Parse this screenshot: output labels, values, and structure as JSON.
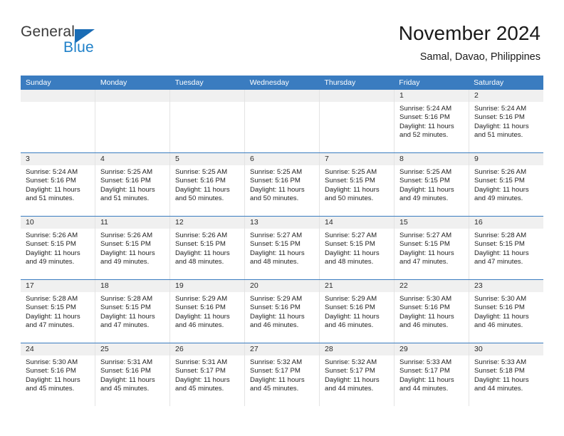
{
  "brand": {
    "name_part1": "General",
    "name_part2": "Blue"
  },
  "header": {
    "title": "November 2024",
    "subtitle": "Samal, Davao, Philippines"
  },
  "weekdays": [
    "Sunday",
    "Monday",
    "Tuesday",
    "Wednesday",
    "Thursday",
    "Friday",
    "Saturday"
  ],
  "colors": {
    "header_blue": "#3a7cc0",
    "logo_blue": "#2081c9",
    "day_bar_gray": "#f0f0f0"
  },
  "weeks": [
    [
      {
        "day": "",
        "empty": true
      },
      {
        "day": "",
        "empty": true
      },
      {
        "day": "",
        "empty": true
      },
      {
        "day": "",
        "empty": true
      },
      {
        "day": "",
        "empty": true
      },
      {
        "day": "1",
        "sunrise": "Sunrise: 5:24 AM",
        "sunset": "Sunset: 5:16 PM",
        "daylight1": "Daylight: 11 hours",
        "daylight2": "and 52 minutes."
      },
      {
        "day": "2",
        "sunrise": "Sunrise: 5:24 AM",
        "sunset": "Sunset: 5:16 PM",
        "daylight1": "Daylight: 11 hours",
        "daylight2": "and 51 minutes."
      }
    ],
    [
      {
        "day": "3",
        "sunrise": "Sunrise: 5:24 AM",
        "sunset": "Sunset: 5:16 PM",
        "daylight1": "Daylight: 11 hours",
        "daylight2": "and 51 minutes."
      },
      {
        "day": "4",
        "sunrise": "Sunrise: 5:25 AM",
        "sunset": "Sunset: 5:16 PM",
        "daylight1": "Daylight: 11 hours",
        "daylight2": "and 51 minutes."
      },
      {
        "day": "5",
        "sunrise": "Sunrise: 5:25 AM",
        "sunset": "Sunset: 5:16 PM",
        "daylight1": "Daylight: 11 hours",
        "daylight2": "and 50 minutes."
      },
      {
        "day": "6",
        "sunrise": "Sunrise: 5:25 AM",
        "sunset": "Sunset: 5:16 PM",
        "daylight1": "Daylight: 11 hours",
        "daylight2": "and 50 minutes."
      },
      {
        "day": "7",
        "sunrise": "Sunrise: 5:25 AM",
        "sunset": "Sunset: 5:15 PM",
        "daylight1": "Daylight: 11 hours",
        "daylight2": "and 50 minutes."
      },
      {
        "day": "8",
        "sunrise": "Sunrise: 5:25 AM",
        "sunset": "Sunset: 5:15 PM",
        "daylight1": "Daylight: 11 hours",
        "daylight2": "and 49 minutes."
      },
      {
        "day": "9",
        "sunrise": "Sunrise: 5:26 AM",
        "sunset": "Sunset: 5:15 PM",
        "daylight1": "Daylight: 11 hours",
        "daylight2": "and 49 minutes."
      }
    ],
    [
      {
        "day": "10",
        "sunrise": "Sunrise: 5:26 AM",
        "sunset": "Sunset: 5:15 PM",
        "daylight1": "Daylight: 11 hours",
        "daylight2": "and 49 minutes."
      },
      {
        "day": "11",
        "sunrise": "Sunrise: 5:26 AM",
        "sunset": "Sunset: 5:15 PM",
        "daylight1": "Daylight: 11 hours",
        "daylight2": "and 49 minutes."
      },
      {
        "day": "12",
        "sunrise": "Sunrise: 5:26 AM",
        "sunset": "Sunset: 5:15 PM",
        "daylight1": "Daylight: 11 hours",
        "daylight2": "and 48 minutes."
      },
      {
        "day": "13",
        "sunrise": "Sunrise: 5:27 AM",
        "sunset": "Sunset: 5:15 PM",
        "daylight1": "Daylight: 11 hours",
        "daylight2": "and 48 minutes."
      },
      {
        "day": "14",
        "sunrise": "Sunrise: 5:27 AM",
        "sunset": "Sunset: 5:15 PM",
        "daylight1": "Daylight: 11 hours",
        "daylight2": "and 48 minutes."
      },
      {
        "day": "15",
        "sunrise": "Sunrise: 5:27 AM",
        "sunset": "Sunset: 5:15 PM",
        "daylight1": "Daylight: 11 hours",
        "daylight2": "and 47 minutes."
      },
      {
        "day": "16",
        "sunrise": "Sunrise: 5:28 AM",
        "sunset": "Sunset: 5:15 PM",
        "daylight1": "Daylight: 11 hours",
        "daylight2": "and 47 minutes."
      }
    ],
    [
      {
        "day": "17",
        "sunrise": "Sunrise: 5:28 AM",
        "sunset": "Sunset: 5:15 PM",
        "daylight1": "Daylight: 11 hours",
        "daylight2": "and 47 minutes."
      },
      {
        "day": "18",
        "sunrise": "Sunrise: 5:28 AM",
        "sunset": "Sunset: 5:15 PM",
        "daylight1": "Daylight: 11 hours",
        "daylight2": "and 47 minutes."
      },
      {
        "day": "19",
        "sunrise": "Sunrise: 5:29 AM",
        "sunset": "Sunset: 5:16 PM",
        "daylight1": "Daylight: 11 hours",
        "daylight2": "and 46 minutes."
      },
      {
        "day": "20",
        "sunrise": "Sunrise: 5:29 AM",
        "sunset": "Sunset: 5:16 PM",
        "daylight1": "Daylight: 11 hours",
        "daylight2": "and 46 minutes."
      },
      {
        "day": "21",
        "sunrise": "Sunrise: 5:29 AM",
        "sunset": "Sunset: 5:16 PM",
        "daylight1": "Daylight: 11 hours",
        "daylight2": "and 46 minutes."
      },
      {
        "day": "22",
        "sunrise": "Sunrise: 5:30 AM",
        "sunset": "Sunset: 5:16 PM",
        "daylight1": "Daylight: 11 hours",
        "daylight2": "and 46 minutes."
      },
      {
        "day": "23",
        "sunrise": "Sunrise: 5:30 AM",
        "sunset": "Sunset: 5:16 PM",
        "daylight1": "Daylight: 11 hours",
        "daylight2": "and 46 minutes."
      }
    ],
    [
      {
        "day": "24",
        "sunrise": "Sunrise: 5:30 AM",
        "sunset": "Sunset: 5:16 PM",
        "daylight1": "Daylight: 11 hours",
        "daylight2": "and 45 minutes."
      },
      {
        "day": "25",
        "sunrise": "Sunrise: 5:31 AM",
        "sunset": "Sunset: 5:16 PM",
        "daylight1": "Daylight: 11 hours",
        "daylight2": "and 45 minutes."
      },
      {
        "day": "26",
        "sunrise": "Sunrise: 5:31 AM",
        "sunset": "Sunset: 5:17 PM",
        "daylight1": "Daylight: 11 hours",
        "daylight2": "and 45 minutes."
      },
      {
        "day": "27",
        "sunrise": "Sunrise: 5:32 AM",
        "sunset": "Sunset: 5:17 PM",
        "daylight1": "Daylight: 11 hours",
        "daylight2": "and 45 minutes."
      },
      {
        "day": "28",
        "sunrise": "Sunrise: 5:32 AM",
        "sunset": "Sunset: 5:17 PM",
        "daylight1": "Daylight: 11 hours",
        "daylight2": "and 44 minutes."
      },
      {
        "day": "29",
        "sunrise": "Sunrise: 5:33 AM",
        "sunset": "Sunset: 5:17 PM",
        "daylight1": "Daylight: 11 hours",
        "daylight2": "and 44 minutes."
      },
      {
        "day": "30",
        "sunrise": "Sunrise: 5:33 AM",
        "sunset": "Sunset: 5:18 PM",
        "daylight1": "Daylight: 11 hours",
        "daylight2": "and 44 minutes."
      }
    ]
  ]
}
